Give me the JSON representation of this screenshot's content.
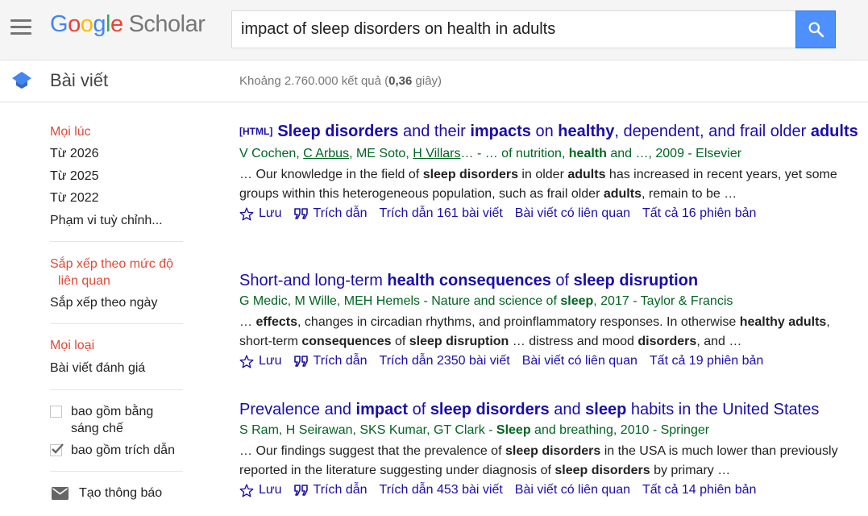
{
  "header": {
    "logo_letters": [
      "G",
      "o",
      "o",
      "g",
      "l",
      "e"
    ],
    "logo_product": "Scholar",
    "search_query": "impact of sleep disorders on health in adults",
    "menu_icon": "hamburger-menu-icon",
    "search_icon": "search-icon"
  },
  "subheader": {
    "section_title": "Bài viết",
    "result_count_prefix": "Khoảng 2.760.000 kết quả (",
    "result_time": "0,36",
    "result_count_suffix": " giây)"
  },
  "sidebar": {
    "time": {
      "active": "Mọi lúc",
      "items": [
        "Từ 2026",
        "Từ 2025",
        "Từ 2022",
        "Phạm vi tuỳ chỉnh..."
      ]
    },
    "sort": {
      "active": "Sắp xếp theo mức độ liên quan",
      "other": "Sắp xếp theo ngày"
    },
    "type": {
      "active": "Mọi loại",
      "other": "Bài viết đánh giá"
    },
    "include_patents": {
      "label": "bao gồm bằng sáng chế",
      "checked": false
    },
    "include_citations": {
      "label": "bao gồm trích dẫn",
      "checked": true
    },
    "create_alert": "Tạo thông báo"
  },
  "action_labels": {
    "save": "Lưu",
    "cite": "Trích dẫn",
    "related": "Bài viết có liên quan"
  },
  "results": [
    {
      "tag": "[HTML]",
      "title": "Sleep disorders and their impacts on healthy, dependent, and frail older adults",
      "meta": "V Cochen, C Arbus, ME Soto, H Villars… - … of nutrition, health and …, 2009 - Elsevier",
      "snippet": "… Our knowledge in the field of sleep disorders in older adults has increased in recent years, yet some groups within this heterogeneous population, such as frail older adults, remain to be …",
      "cited_by": "Trích dẫn 161 bài viết",
      "versions": "Tất cả 16 phiên bản"
    },
    {
      "tag": "",
      "title": "Short-and long-term health consequences of sleep disruption",
      "meta": "G Medic, M Wille, MEH Hemels - Nature and science of sleep, 2017 - Taylor & Francis",
      "snippet": "… effects, changes in circadian rhythms, and proinflammatory responses. In otherwise healthy adults, short-term consequences of sleep disruption … distress and mood disorders, and …",
      "cited_by": "Trích dẫn 2350 bài viết",
      "versions": "Tất cả 19 phiên bản"
    },
    {
      "tag": "",
      "title": "Prevalence and impact of sleep disorders and sleep habits in the United States",
      "meta": "S Ram, H Seirawan, SKS Kumar, GT Clark - Sleep and breathing, 2010 - Springer",
      "snippet": "… Our findings suggest that the prevalence of sleep disorders in the USA is much lower than previously reported in the literature suggesting under diagnosis of sleep disorders by primary …",
      "cited_by": "Trích dẫn 453 bài viết",
      "versions": "Tất cả 14 phiên bản"
    }
  ],
  "colors": {
    "title_link": "#1a0dab",
    "meta_green": "#006621",
    "active_red": "#dd4b39",
    "search_button": "#4d90fe"
  }
}
